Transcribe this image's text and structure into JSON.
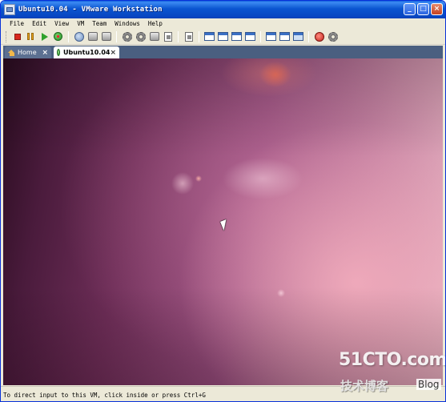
{
  "window": {
    "title": "Ubuntu10.04 - VMware Workstation",
    "controls": {
      "minimize": "_",
      "maximize": "□",
      "close": "×"
    }
  },
  "menu": {
    "items": [
      "File",
      "Edit",
      "View",
      "VM",
      "Team",
      "Windows",
      "Help"
    ]
  },
  "toolbar": {
    "icons": [
      "power-off-icon",
      "suspend-icon",
      "power-on-icon",
      "reset-icon",
      "snapshot-icon",
      "revert-snapshot-icon",
      "snapshot-manager-icon",
      "settings-icon",
      "console-icon",
      "clone-icon",
      "quick-switch-icon",
      "full-screen-icon",
      "unity-icon",
      "summary-view-icon",
      "console-view-icon",
      "team-icon",
      "power-options-icon"
    ]
  },
  "tabs": [
    {
      "label": "Home",
      "close": "×"
    },
    {
      "label": "Ubuntu10.04",
      "close": "×"
    }
  ],
  "watermark": {
    "main": "51CTO.com",
    "sub": "技术博客",
    "blog": "Blog"
  },
  "status": {
    "text": "To direct input to this VM, click inside or press Ctrl+G"
  },
  "colors": {
    "title_bar": "#0a55d0",
    "tab_bar": "#4a5f80",
    "chrome": "#ece9d8"
  }
}
